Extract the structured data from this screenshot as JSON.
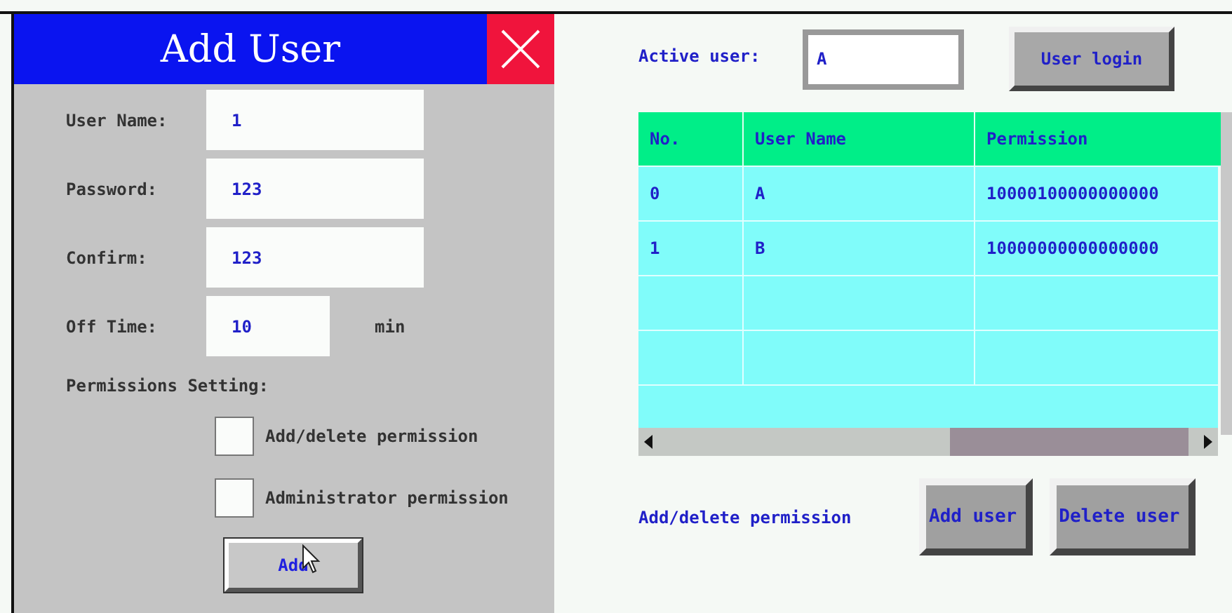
{
  "dialog": {
    "title": "Add User",
    "fields": [
      {
        "label": "User Name:",
        "value": "1"
      },
      {
        "label": "Password:",
        "value": "123"
      },
      {
        "label": "Confirm:",
        "value": "123"
      }
    ],
    "off_time": {
      "label": "Off Time:",
      "value": "10",
      "unit": "min"
    },
    "permissions_label": "Permissions Setting:",
    "permissions": [
      {
        "label": "Add/delete permission",
        "checked": false
      },
      {
        "label": "Administrator permission",
        "checked": false
      }
    ],
    "add_button": "Add"
  },
  "active_user": {
    "label": "Active user:",
    "value": "A"
  },
  "login_button": "User login",
  "table": {
    "columns": [
      "No.",
      "User Name",
      "Permission"
    ],
    "rows": [
      {
        "no": "0",
        "name": "A",
        "permission": "10000100000000000"
      },
      {
        "no": "1",
        "name": "B",
        "permission": "10000000000000000"
      }
    ]
  },
  "footer": {
    "label": "Add/delete permission",
    "buttons": [
      "Add user",
      "Delete user"
    ]
  }
}
